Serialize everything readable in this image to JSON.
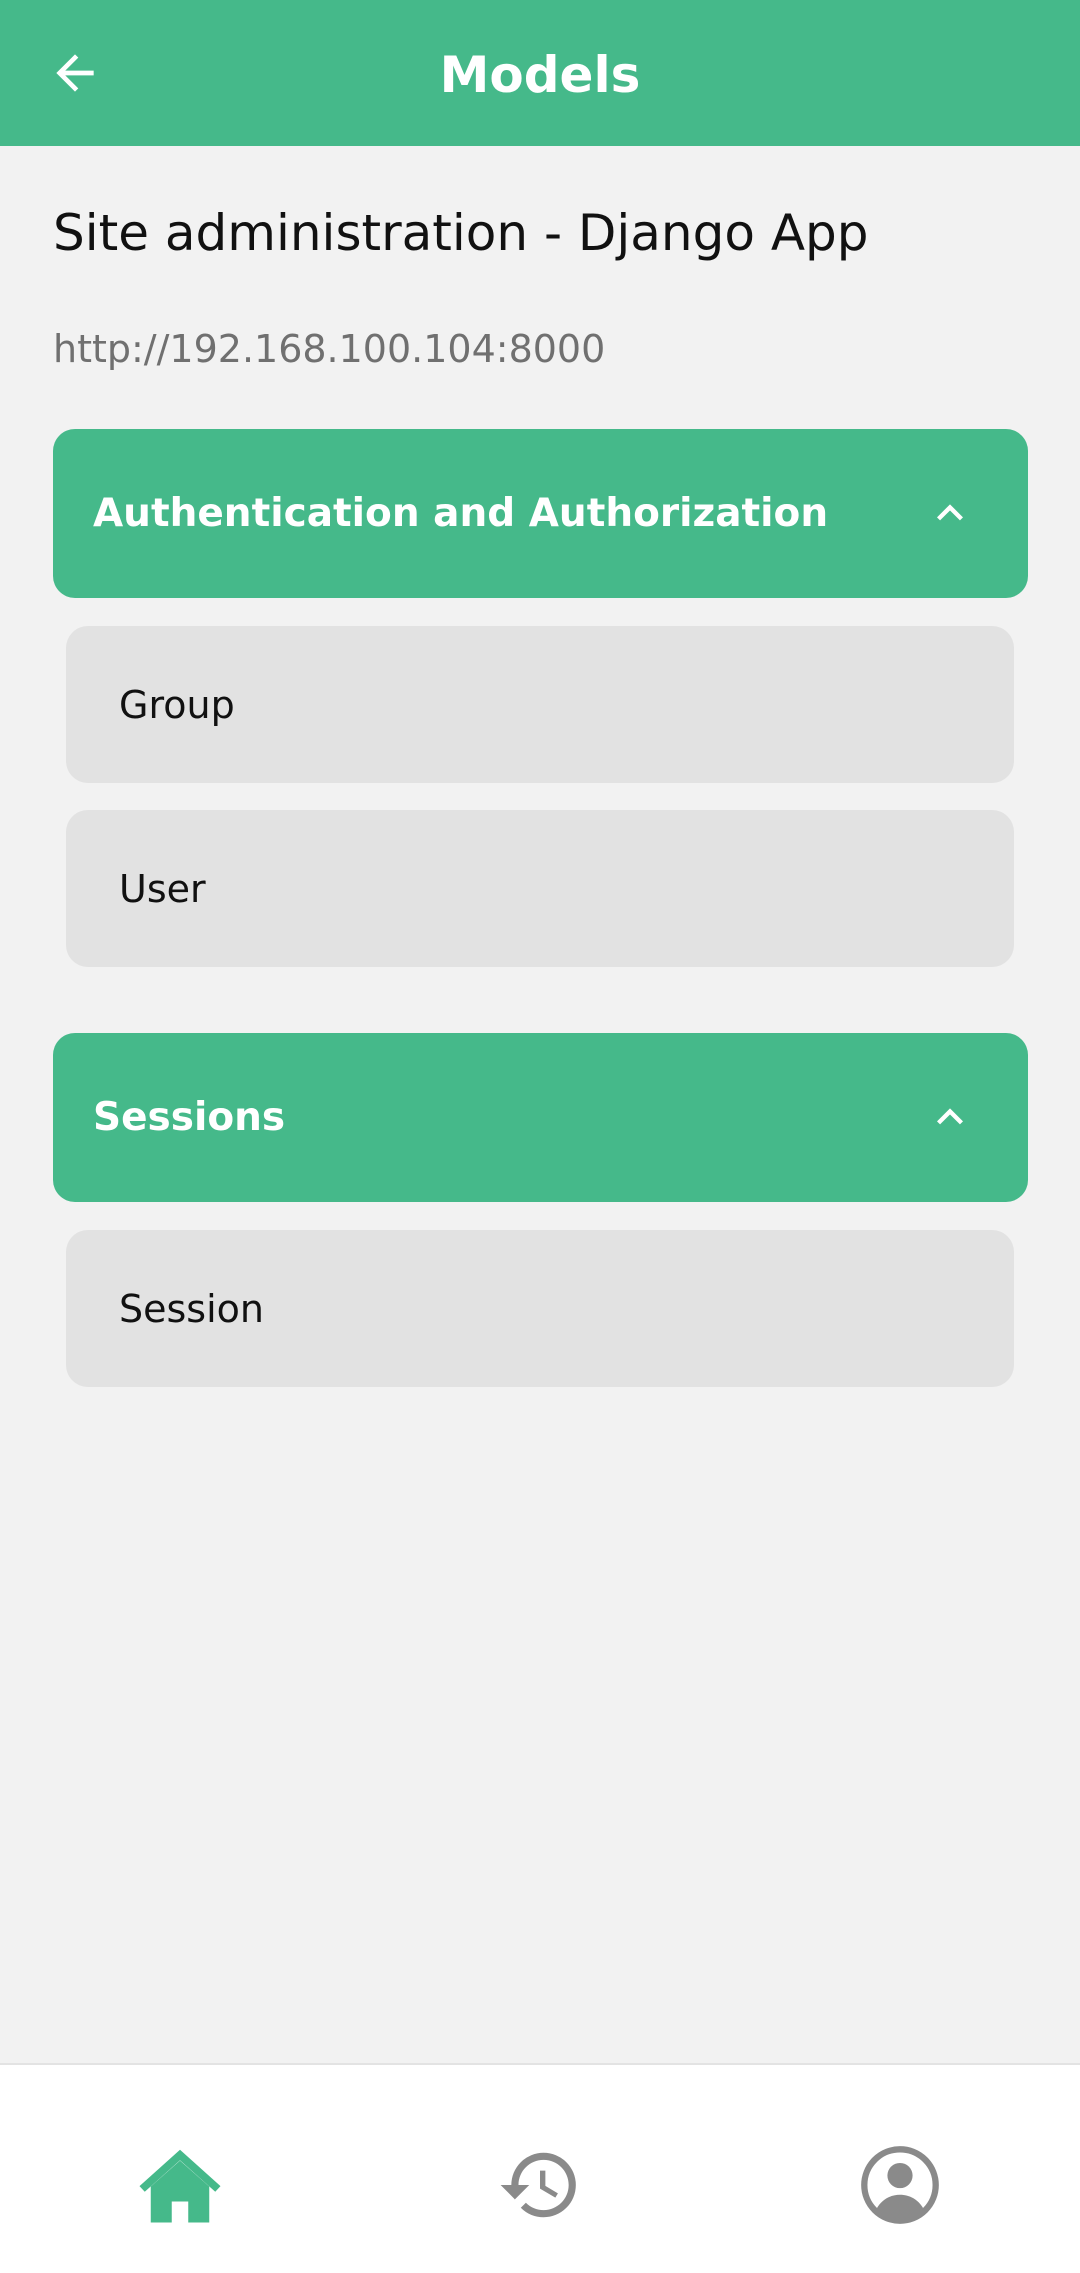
{
  "appbar": {
    "title": "Models",
    "back_icon": "arrow-left-icon"
  },
  "header": {
    "title": "Site administration - Django App",
    "url": "http://192.168.100.104:8000"
  },
  "sections": [
    {
      "label": "Authentication and Authorization",
      "expanded": true,
      "items": [
        {
          "label": "Group"
        },
        {
          "label": "User"
        }
      ]
    },
    {
      "label": "Sessions",
      "expanded": true,
      "items": [
        {
          "label": "Session"
        }
      ]
    }
  ],
  "bottom_nav": {
    "items": [
      {
        "icon": "home-icon",
        "active": true
      },
      {
        "icon": "history-icon",
        "active": false
      },
      {
        "icon": "account-icon",
        "active": false
      }
    ]
  },
  "colors": {
    "primary": "#45b98a",
    "background": "#f2f2f2",
    "item_background": "#e2e2e2",
    "inactive_icon": "#8a8a8a"
  }
}
